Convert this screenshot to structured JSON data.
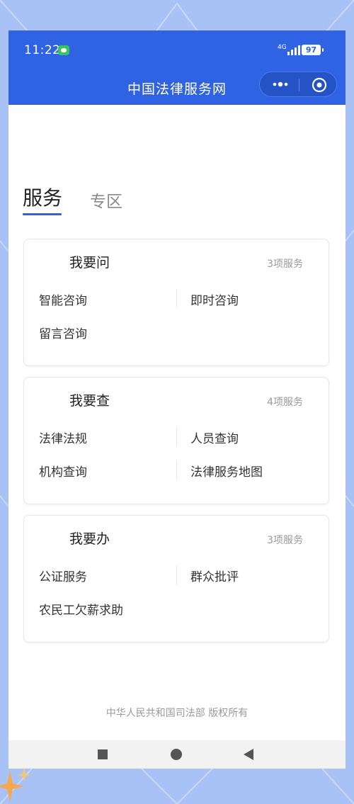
{
  "status_bar": {
    "time": "11:22",
    "network": "4G",
    "battery": "97",
    "icons": [
      "message-icon",
      "signal-icon",
      "battery-icon"
    ]
  },
  "nav": {
    "title": "中国法律服务网",
    "icons": [
      "more-icon",
      "close-capsule-icon"
    ]
  },
  "tabs": [
    {
      "label": "服务",
      "active": true
    },
    {
      "label": "专区",
      "active": false
    }
  ],
  "cards": [
    {
      "title": "我要问",
      "count": "3项服务",
      "items": [
        "智能咨询",
        "即时咨询",
        "留言咨询"
      ]
    },
    {
      "title": "我要查",
      "count": "4项服务",
      "items": [
        "法律法规",
        "人员查询",
        "机构查询",
        "法律服务地图"
      ]
    },
    {
      "title": "我要办",
      "count": "3项服务",
      "items": [
        "公证服务",
        "群众批评",
        "农民工欠薪求助"
      ]
    }
  ],
  "footer": "中华人民共和国司法部 版权所有",
  "system_nav": [
    "recents-icon",
    "home-icon",
    "back-icon"
  ],
  "colors": {
    "primary": "#2f63e3",
    "background": "#a9c2f5",
    "card_border": "#e4e7ee"
  }
}
